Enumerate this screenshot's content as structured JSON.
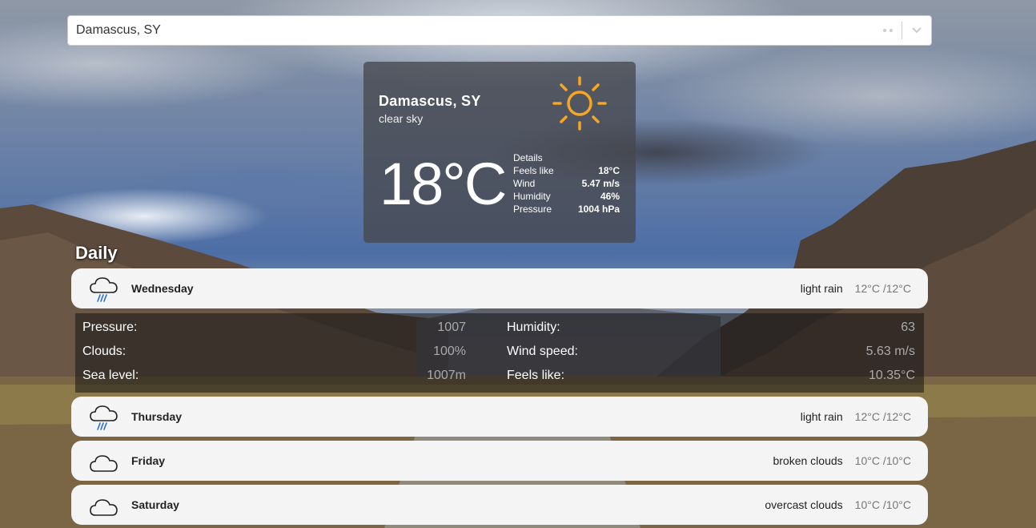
{
  "search": {
    "value": "Damascus, SY"
  },
  "current": {
    "city": "Damascus, SY",
    "description": "clear sky",
    "temperature": "18°C",
    "icon": "sun-icon",
    "details_title": "Details",
    "details": [
      {
        "label": "Feels like",
        "value": "18°C"
      },
      {
        "label": "Wind",
        "value": "5.47 m/s"
      },
      {
        "label": "Humidity",
        "value": "46%"
      },
      {
        "label": "Pressure",
        "value": "1004 hPa"
      }
    ]
  },
  "daily": {
    "title": "Daily",
    "days": [
      {
        "name": "Wednesday",
        "condition": "light rain",
        "range": "12°C /12°C",
        "icon": "rain-cloud-icon"
      },
      {
        "name": "Thursday",
        "condition": "light rain",
        "range": "12°C /12°C",
        "icon": "rain-cloud-icon"
      },
      {
        "name": "Friday",
        "condition": "broken clouds",
        "range": "10°C /10°C",
        "icon": "cloud-icon"
      },
      {
        "name": "Saturday",
        "condition": "overcast clouds",
        "range": "10°C /10°C",
        "icon": "cloud-icon"
      }
    ],
    "expanded": {
      "pressure_label": "Pressure:",
      "pressure_value": "1007",
      "clouds_label": "Clouds:",
      "clouds_value": "100%",
      "sea_level_label": "Sea level:",
      "sea_level_value": "1007m",
      "humidity_label": "Humidity:",
      "humidity_value": "63",
      "wind_speed_label": "Wind speed:",
      "wind_speed_value": "5.63 m/s",
      "feels_like_label": "Feels like:",
      "feels_like_value": "10.35°C"
    }
  },
  "colors": {
    "sun": "#f5a623",
    "card_bg": "#f4f4f4"
  }
}
